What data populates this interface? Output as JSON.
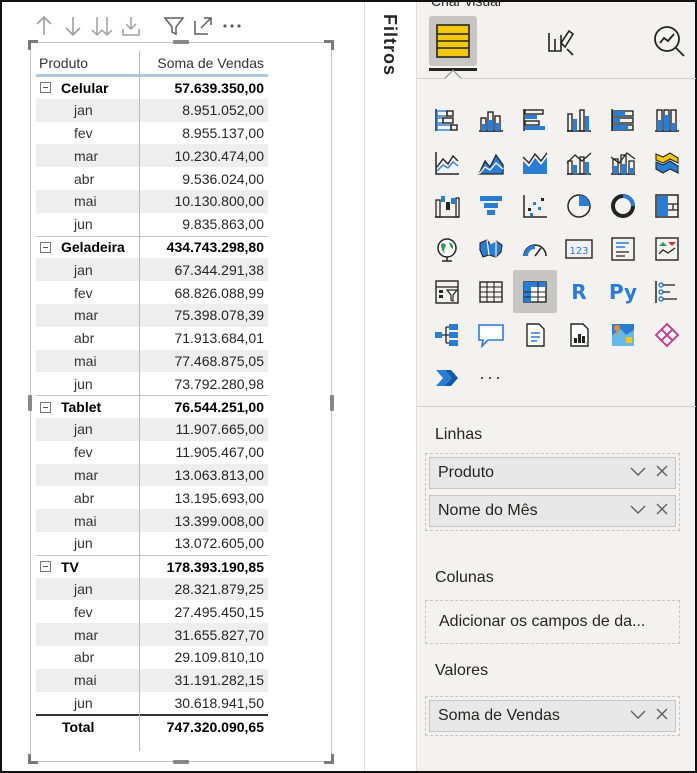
{
  "visual_header": {
    "icons": [
      "arrow-up-icon",
      "arrow-down-icon",
      "double-arrow-down-icon",
      "expand-hierarchy-icon",
      "filter-icon",
      "focus-mode-icon",
      "more-options-icon"
    ]
  },
  "matrix": {
    "headers": {
      "row": "Produto",
      "value": "Soma de Vendas"
    },
    "groups": [
      {
        "label": "Celular",
        "total": "57.639.350,00",
        "rows": [
          {
            "month": "jan",
            "value": "8.951.052,00"
          },
          {
            "month": "fev",
            "value": "8.955.137,00"
          },
          {
            "month": "mar",
            "value": "10.230.474,00"
          },
          {
            "month": "abr",
            "value": "9.536.024,00"
          },
          {
            "month": "mai",
            "value": "10.130.800,00"
          },
          {
            "month": "jun",
            "value": "9.835.863,00"
          }
        ]
      },
      {
        "label": "Geladeira",
        "total": "434.743.298,80",
        "rows": [
          {
            "month": "jan",
            "value": "67.344.291,38"
          },
          {
            "month": "fev",
            "value": "68.826.088,99"
          },
          {
            "month": "mar",
            "value": "75.398.078,39"
          },
          {
            "month": "abr",
            "value": "71.913.684,01"
          },
          {
            "month": "mai",
            "value": "77.468.875,05"
          },
          {
            "month": "jun",
            "value": "73.792.280,98"
          }
        ]
      },
      {
        "label": "Tablet",
        "total": "76.544.251,00",
        "rows": [
          {
            "month": "jan",
            "value": "11.907.665,00"
          },
          {
            "month": "fev",
            "value": "11.905.467,00"
          },
          {
            "month": "mar",
            "value": "13.063.813,00"
          },
          {
            "month": "abr",
            "value": "13.195.693,00"
          },
          {
            "month": "mai",
            "value": "13.399.008,00"
          },
          {
            "month": "jun",
            "value": "13.072.605,00"
          }
        ]
      },
      {
        "label": "TV",
        "total": "178.393.190,85",
        "rows": [
          {
            "month": "jan",
            "value": "28.321.879,25"
          },
          {
            "month": "fev",
            "value": "27.495.450,15"
          },
          {
            "month": "mar",
            "value": "31.655.827,70"
          },
          {
            "month": "abr",
            "value": "29.109.810,10"
          },
          {
            "month": "mai",
            "value": "31.191.282,15"
          },
          {
            "month": "jun",
            "value": "30.618.941,50"
          }
        ]
      }
    ],
    "total": {
      "label": "Total",
      "value": "747.320.090,65"
    }
  },
  "filters": {
    "label": "Filtros"
  },
  "viz_pane": {
    "title": "Criar visual",
    "tabs": [
      "build-visual-icon",
      "format-visual-icon",
      "analytics-icon"
    ],
    "visual_icons": [
      "stacked-bar-chart-icon",
      "stacked-column-chart-icon",
      "clustered-bar-chart-icon",
      "clustered-column-chart-icon",
      "100-stacked-bar-chart-icon",
      "100-stacked-column-chart-icon",
      "line-chart-icon",
      "area-chart-icon",
      "stacked-area-chart-icon",
      "line-clustered-column-chart-icon",
      "line-stacked-column-chart-icon",
      "ribbon-chart-icon",
      "waterfall-chart-icon",
      "funnel-chart-icon",
      "scatter-chart-icon",
      "pie-chart-icon",
      "donut-chart-icon",
      "treemap-icon",
      "map-icon",
      "filled-map-icon",
      "gauge-icon",
      "card-icon",
      "multi-row-card-icon",
      "kpi-icon",
      "slicer-icon",
      "table-icon",
      "matrix-icon",
      "r-script-visual-icon",
      "python-visual-icon",
      "key-influencers-icon",
      "decomposition-tree-icon",
      "qa-icon",
      "smart-narrative-icon",
      "paginated-report-icon",
      "arcgis-map-icon",
      "power-apps-icon",
      "power-automate-icon",
      "more-visuals-icon"
    ],
    "r_label": "R",
    "py_label": "Py",
    "more_label": "···",
    "rows_well": {
      "label": "Linhas",
      "fields": [
        "Produto",
        "Nome do Mês"
      ]
    },
    "columns_well": {
      "label": "Colunas",
      "placeholder": "Adicionar os campos de da..."
    },
    "values_well": {
      "label": "Valores",
      "fields": [
        "Soma de Vendas"
      ]
    }
  },
  "colors": {
    "accent_yellow": "#f2c811",
    "accent_blue": "#2b7cd3",
    "matrix_line": "#9dbfe6",
    "row_shade": "#eeeeee"
  }
}
